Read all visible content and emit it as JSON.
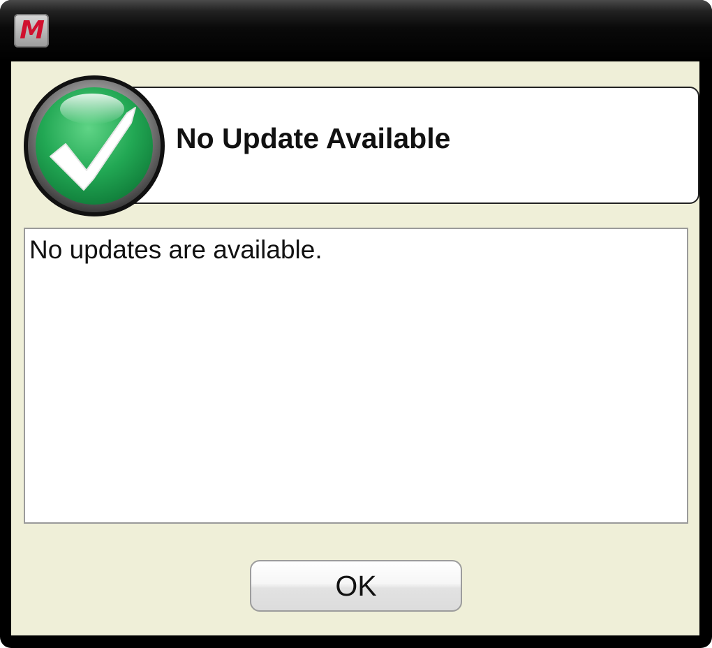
{
  "window": {
    "app_icon_letter": "M",
    "app_icon_name": "mcafee-m-icon"
  },
  "header": {
    "title": "No Update Available",
    "status_icon": "green-checkmark-icon"
  },
  "message": {
    "text": "No updates are available."
  },
  "buttons": {
    "ok_label": "OK"
  },
  "colors": {
    "client_background": "#efefd8",
    "titlebar": "#000000",
    "brand_red": "#d0102e",
    "check_green": "#1fa24f"
  }
}
